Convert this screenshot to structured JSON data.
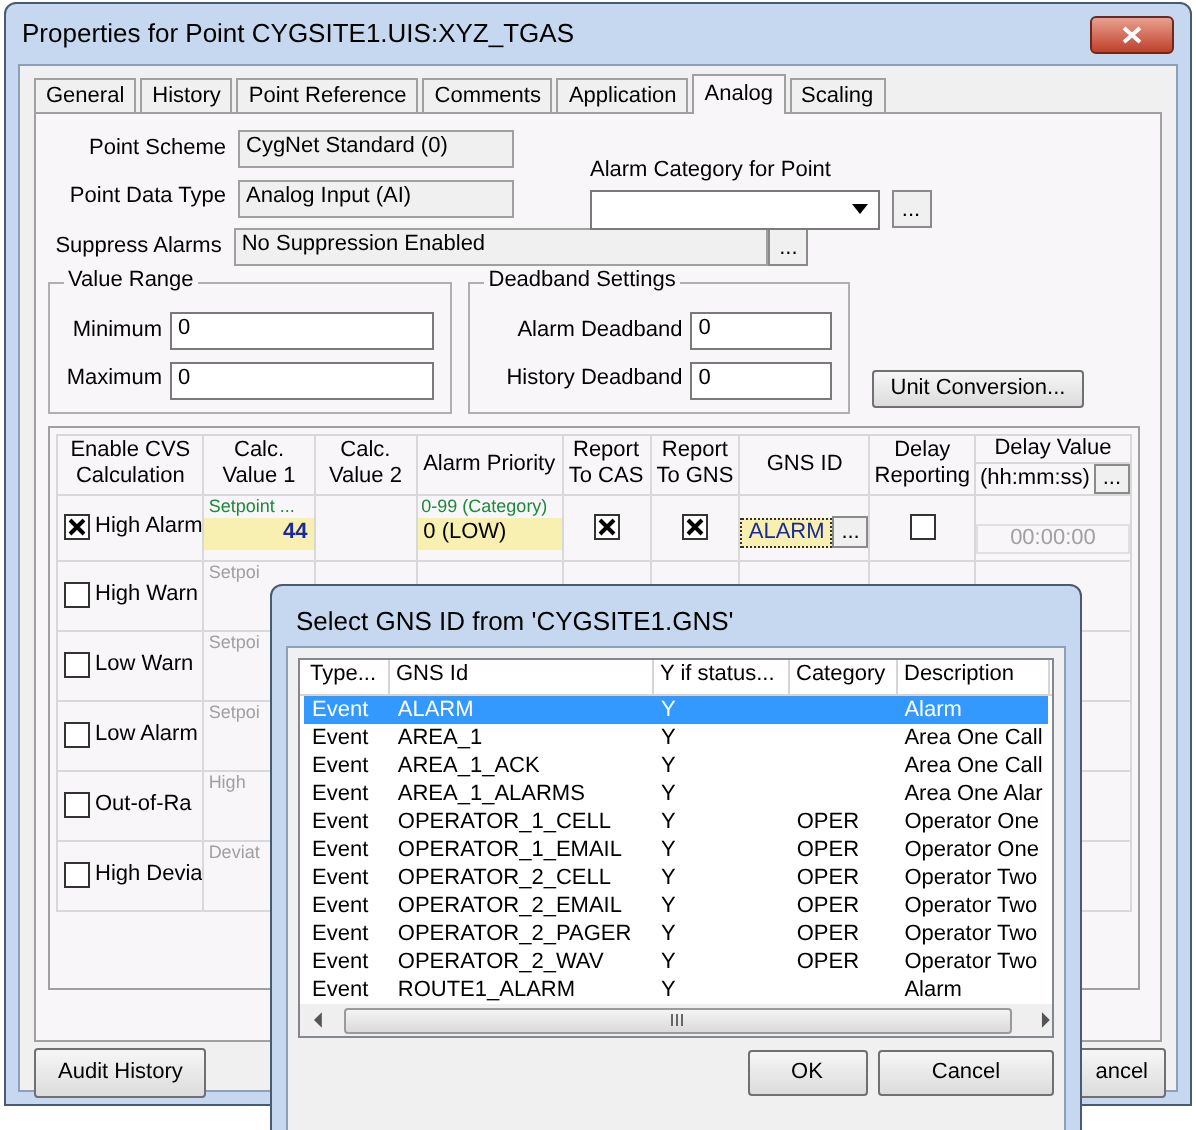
{
  "window": {
    "title": "Properties for Point CYGSITE1.UIS:XYZ_TGAS"
  },
  "tabs": [
    {
      "label": "General",
      "selected": false
    },
    {
      "label": "History",
      "selected": false
    },
    {
      "label": "Point Reference",
      "selected": false
    },
    {
      "label": "Comments",
      "selected": false
    },
    {
      "label": "Application",
      "selected": false
    },
    {
      "label": "Analog",
      "selected": true
    },
    {
      "label": "Scaling",
      "selected": false
    }
  ],
  "point_scheme": {
    "label": "Point Scheme",
    "value": "CygNet Standard (0)"
  },
  "point_data_type": {
    "label": "Point Data Type",
    "value": "Analog Input (AI)"
  },
  "alarm_category": {
    "label": "Alarm Category for Point",
    "browse": "..."
  },
  "suppress_alarms": {
    "label": "Suppress Alarms",
    "value": "No Suppression Enabled",
    "browse": "..."
  },
  "value_range": {
    "title": "Value Range",
    "fields": [
      {
        "label": "Minimum",
        "value": "0"
      },
      {
        "label": "Maximum",
        "value": "0"
      }
    ]
  },
  "deadband_settings": {
    "title": "Deadband Settings",
    "fields": [
      {
        "label": "Alarm Deadband",
        "value": "0"
      },
      {
        "label": "History Deadband",
        "value": "0"
      }
    ]
  },
  "unit_conversion_button": "Unit Conversion...",
  "grid": {
    "columns": [
      "Enable CVS Calculation",
      "Calc. Value 1",
      "Calc. Value 2",
      "Alarm Priority",
      "Report To CAS",
      "Report To GNS",
      "GNS ID",
      "Delay Reporting",
      "Delay Value"
    ],
    "delay_value_format": "(hh:mm:ss)",
    "delay_value_browse": "...",
    "rows": [
      {
        "label": "High Alarm",
        "checked": true,
        "calc_hint": "Setpoint ...",
        "calc_value": "44",
        "priority_hint": "0-99 (Category)",
        "priority": "0 (LOW)",
        "report_to_cas": true,
        "report_to_gns": true,
        "gns_id": "ALARM",
        "gns_browse": "...",
        "delay_reporting": false,
        "delay_value": "00:00:00"
      },
      {
        "label": "High Warn",
        "checked": false,
        "calc_hint": "Setpoi"
      },
      {
        "label": "Low Warn",
        "checked": false,
        "calc_hint": "Setpoi"
      },
      {
        "label": "Low Alarm",
        "checked": false,
        "calc_hint": "Setpoi"
      },
      {
        "label": "Out-of-Ra",
        "checked": false,
        "calc_hint": "High"
      },
      {
        "label": "High Devia",
        "checked": false,
        "calc_hint": "Deviat"
      }
    ]
  },
  "audit_history_button": "Audit History",
  "cancel_button": "ancel",
  "dialog": {
    "title": "Select GNS ID from 'CYGSITE1.GNS'",
    "columns": [
      "Type...",
      "GNS Id",
      "Y if status...",
      "Category",
      "Description"
    ],
    "rows": [
      {
        "type": "Event",
        "gns_id": "ALARM",
        "status": "Y",
        "category": "",
        "description": "Alarm",
        "selected": true
      },
      {
        "type": "Event",
        "gns_id": "AREA_1",
        "status": "Y",
        "category": "",
        "description": "Area One Call",
        "selected": false
      },
      {
        "type": "Event",
        "gns_id": "AREA_1_ACK",
        "status": "Y",
        "category": "",
        "description": "Area One Call",
        "selected": false
      },
      {
        "type": "Event",
        "gns_id": "AREA_1_ALARMS",
        "status": "Y",
        "category": "",
        "description": "Area One Alar",
        "selected": false
      },
      {
        "type": "Event",
        "gns_id": "OPERATOR_1_CELL",
        "status": "Y",
        "category": "OPER",
        "description": "Operator One",
        "selected": false
      },
      {
        "type": "Event",
        "gns_id": "OPERATOR_1_EMAIL",
        "status": "Y",
        "category": "OPER",
        "description": "Operator One",
        "selected": false
      },
      {
        "type": "Event",
        "gns_id": "OPERATOR_2_CELL",
        "status": "Y",
        "category": "OPER",
        "description": "Operator Two",
        "selected": false
      },
      {
        "type": "Event",
        "gns_id": "OPERATOR_2_EMAIL",
        "status": "Y",
        "category": "OPER",
        "description": "Operator Two",
        "selected": false
      },
      {
        "type": "Event",
        "gns_id": "OPERATOR_2_PAGER",
        "status": "Y",
        "category": "OPER",
        "description": "Operator Two",
        "selected": false
      },
      {
        "type": "Event",
        "gns_id": "OPERATOR_2_WAV",
        "status": "Y",
        "category": "OPER",
        "description": "Operator Two",
        "selected": false
      },
      {
        "type": "Event",
        "gns_id": "ROUTE1_ALARM",
        "status": "Y",
        "category": "",
        "description": "Alarm",
        "selected": false
      }
    ],
    "buttons": [
      "OK",
      "Cancel"
    ]
  }
}
